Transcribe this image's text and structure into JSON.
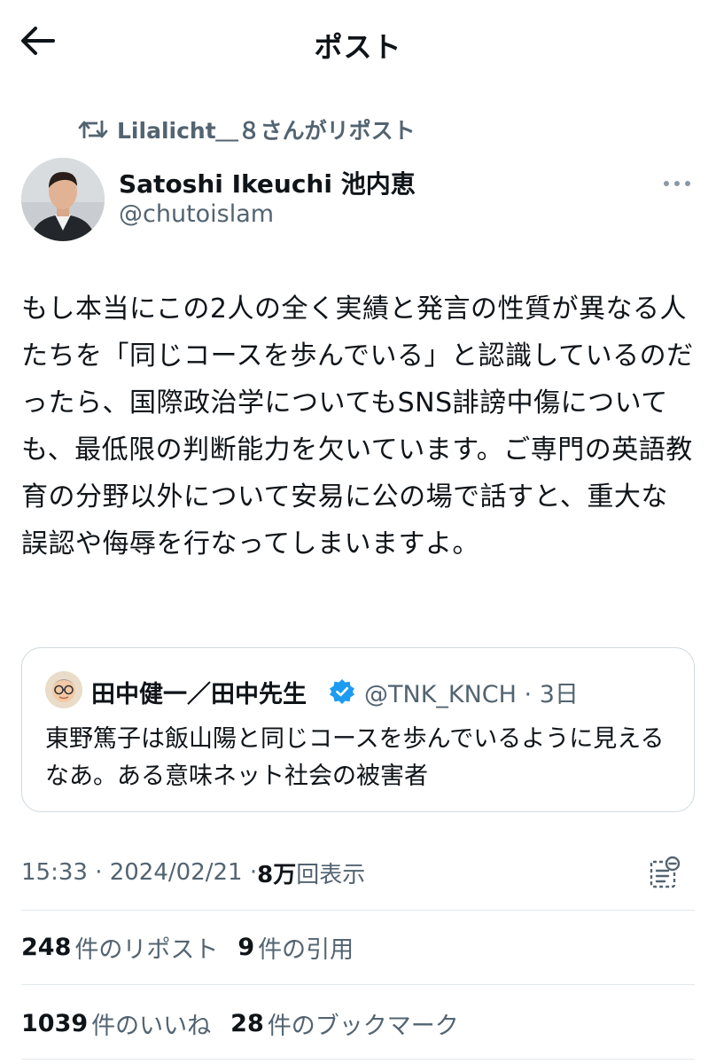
{
  "header": {
    "title": "ポスト"
  },
  "repost": {
    "text": "Lilalicht＿８さんがリポスト"
  },
  "tweet": {
    "author_name": "Satoshi Ikeuchi 池内恵",
    "author_handle": "@chutoislam",
    "text": "もし本当にこの2人の全く実績と発言の性質が異なる人たちを「同じコースを歩んでいる」と認識しているのだったら、国際政治学についてもSNS誹謗中傷についても、最低限の判断能力を欠いています。ご専門の英語教育の分野以外について安易に公の場で話すと、重大な誤認や侮辱を行なってしまいますよ。"
  },
  "quote": {
    "author_name": "田中健一／田中先生",
    "meta": "@TNK_KNCH · 3日",
    "text": "東野篤子は飯山陽と同じコースを歩んでいるように見えるなあ。ある意味ネット社会の被害者"
  },
  "timestamp": {
    "time_date": "15:33 · 2024/02/21 · ",
    "views_count": "8万",
    "views_label": "回表示"
  },
  "stats": {
    "reposts_count": "248",
    "reposts_label": "件のリポスト",
    "quotes_count": "9",
    "quotes_label": "件の引用",
    "likes_count": "1039",
    "likes_label": "件のいいね",
    "bookmarks_count": "28",
    "bookmarks_label": "件のブックマーク"
  },
  "colors": {
    "text": "#0f1419",
    "secondary": "#536471",
    "verified": "#1d9bf0",
    "border": "#cfd9de"
  },
  "icons": {
    "back": "arrow-left-icon",
    "repost": "repost-icon",
    "more": "more-horizontal-icon",
    "verified": "verified-badge-icon",
    "analytics": "analytics-icon"
  }
}
